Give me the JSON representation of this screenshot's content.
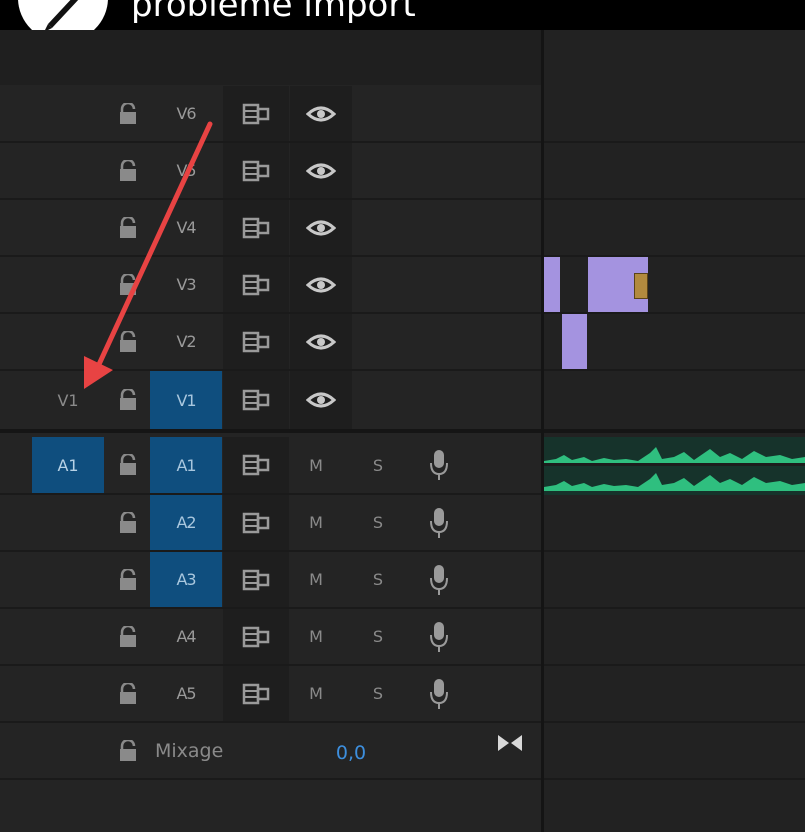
{
  "video": {
    "title": "problème import"
  },
  "video_tracks": [
    {
      "name": "V6",
      "sync_icon": "sync-lock-icon",
      "eye_icon": "eye-icon",
      "lock_icon": "lock-icon"
    },
    {
      "name": "V5",
      "sync_icon": "sync-lock-icon",
      "eye_icon": "eye-icon",
      "lock_icon": "lock-icon"
    },
    {
      "name": "V4",
      "sync_icon": "sync-lock-icon",
      "eye_icon": "eye-icon",
      "lock_icon": "lock-icon"
    },
    {
      "name": "V3",
      "sync_icon": "sync-lock-icon",
      "eye_icon": "eye-icon",
      "lock_icon": "lock-icon"
    },
    {
      "name": "V2",
      "sync_icon": "sync-lock-icon",
      "eye_icon": "eye-icon",
      "lock_icon": "lock-icon"
    },
    {
      "name": "V1",
      "source": "V1",
      "highlighted": true,
      "sync_icon": "sync-lock-icon",
      "eye_icon": "eye-icon",
      "lock_icon": "lock-icon"
    }
  ],
  "audio_tracks": [
    {
      "name": "A1",
      "source": "A1",
      "highlighted": true,
      "mute": "M",
      "solo": "S",
      "mic_icon": "microphone-icon"
    },
    {
      "name": "A2",
      "highlighted": true,
      "mute": "M",
      "solo": "S",
      "mic_icon": "microphone-icon"
    },
    {
      "name": "A3",
      "highlighted": true,
      "mute": "M",
      "solo": "S",
      "mic_icon": "microphone-icon"
    },
    {
      "name": "A4",
      "highlighted": false,
      "mute": "M",
      "solo": "S",
      "mic_icon": "microphone-icon"
    },
    {
      "name": "A5",
      "highlighted": false,
      "mute": "M",
      "solo": "S",
      "mic_icon": "microphone-icon"
    }
  ],
  "mix": {
    "label": "Mixage",
    "value": "0,0"
  },
  "colors": {
    "selected_track": "#0f4e7e",
    "video_clip": "#a493e0",
    "audio_waveform": "#2fbf7f",
    "annotation_arrow": "#e84343",
    "mix_value": "#3d8fde"
  }
}
